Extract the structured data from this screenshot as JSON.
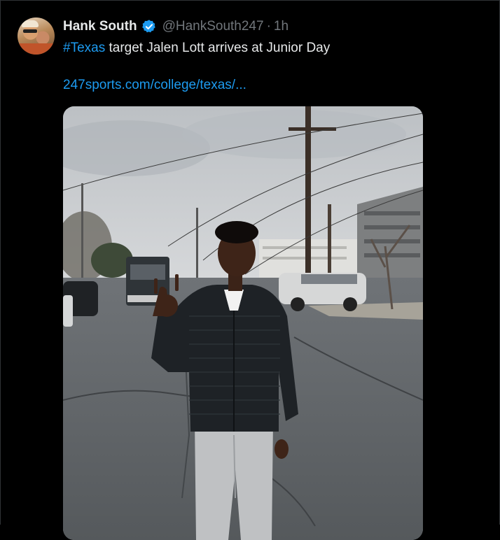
{
  "tweet": {
    "author": {
      "display_name": "Hank South",
      "handle": "@HankSouth247",
      "verified": true
    },
    "separator": "·",
    "timestamp": "1h",
    "text": {
      "hashtag": "#Texas",
      "body": " target Jalen Lott arrives at Junior Day"
    },
    "link": "247sports.com/college/texas/...",
    "media": {
      "type": "photo"
    }
  },
  "colors": {
    "background": "#000000",
    "text": "#e7e9ea",
    "muted": "#71767b",
    "accent": "#1d9bf0",
    "border": "#2f3336"
  },
  "icons": {
    "verified": "verified-badge-icon",
    "avatar": "avatar"
  }
}
